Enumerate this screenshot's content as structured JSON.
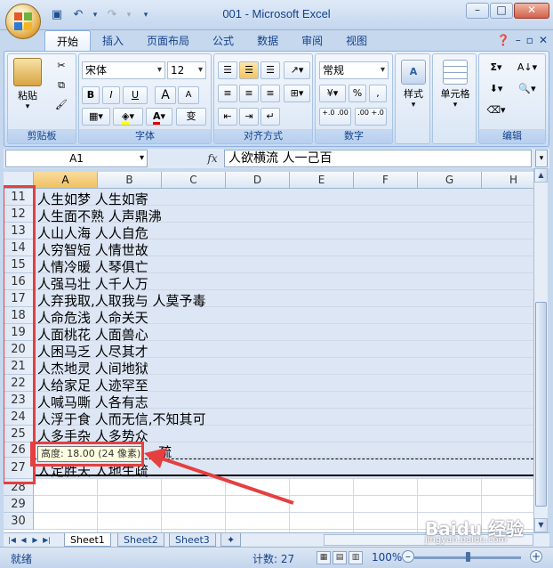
{
  "window": {
    "title": "001 - Microsoft Excel"
  },
  "ribbon_tabs": [
    "开始",
    "插入",
    "页面布局",
    "公式",
    "数据",
    "审阅",
    "视图"
  ],
  "ribbon": {
    "clipboard": {
      "paste": "粘贴",
      "title": "剪贴板"
    },
    "font": {
      "name": "宋体",
      "size": "12",
      "title": "字体",
      "bold": "B",
      "italic": "I",
      "underline": "U",
      "grow": "A",
      "shrink": "A",
      "wen": "变"
    },
    "alignment": {
      "title": "对齐方式"
    },
    "number": {
      "format": "常规",
      "percent": "%",
      "comma": ",",
      "inc_decimal": "+.0 .00",
      "dec_decimal": ".00 +.0",
      "title": "数字"
    },
    "styles": {
      "label": "样式"
    },
    "cells": {
      "label": "单元格"
    },
    "editing": {
      "sum": "Σ",
      "title": "编辑"
    }
  },
  "formula_bar": {
    "name_box": "A1",
    "fx": "fx",
    "content": "人欲横流 人一己百"
  },
  "columns": [
    "A",
    "B",
    "C",
    "D",
    "E",
    "F",
    "G",
    "H"
  ],
  "rows": [
    {
      "num": "11",
      "text": "人生如梦 人生如寄"
    },
    {
      "num": "12",
      "text": "人生面不熟 人声鼎沸"
    },
    {
      "num": "13",
      "text": "人山人海 人人自危"
    },
    {
      "num": "14",
      "text": "人穷智短 人情世故"
    },
    {
      "num": "15",
      "text": "人情冷暖 人琴俱亡"
    },
    {
      "num": "16",
      "text": "人强马壮 人千人万"
    },
    {
      "num": "17",
      "text": "人弃我取,人取我与 人莫予毒"
    },
    {
      "num": "18",
      "text": "人命危浅 人命关天"
    },
    {
      "num": "19",
      "text": "人面桃花 人面兽心"
    },
    {
      "num": "20",
      "text": "人困马乏 人尽其才"
    },
    {
      "num": "21",
      "text": "人杰地灵 人间地狱"
    },
    {
      "num": "22",
      "text": "人给家足 人迹罕至"
    },
    {
      "num": "23",
      "text": "人喊马嘶 人各有志"
    },
    {
      "num": "24",
      "text": "人浮于食 人而无信,不知其可"
    },
    {
      "num": "25",
      "text": "人多手杂 人多势众"
    },
    {
      "num": "26",
      "text": "疏"
    },
    {
      "num": "27",
      "text": "人定胜天 人地生疏"
    },
    {
      "num": "28",
      "text": ""
    },
    {
      "num": "29",
      "text": ""
    },
    {
      "num": "30",
      "text": ""
    }
  ],
  "tooltip": "高度: 18.00 (24 像素)",
  "sheet_tabs": [
    "Sheet1",
    "Sheet2",
    "Sheet3"
  ],
  "status": {
    "ready": "就绪",
    "count": "计数: 27",
    "zoom": "100%"
  },
  "watermark": {
    "main": "Baidu 经验",
    "sub": "jingyan.baidu.com"
  }
}
